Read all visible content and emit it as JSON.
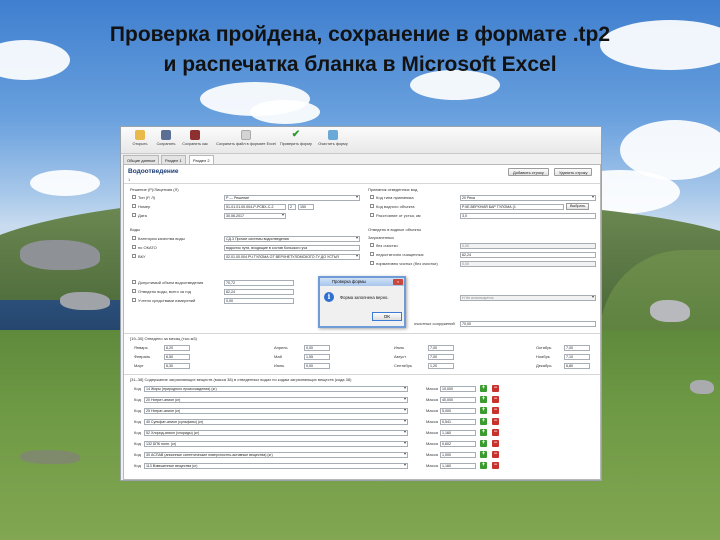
{
  "slide": {
    "title_line1": "Проверка пройдена, сохранение в формате .tp2",
    "title_line2": "и распечатка бланка в Microsoft Excel"
  },
  "toolbar": {
    "buttons": [
      {
        "label": "Открыть",
        "icon": "folder-icon"
      },
      {
        "label": "Сохранить",
        "icon": "save-icon"
      },
      {
        "label": "Сохранить как",
        "icon": "save-as-icon"
      },
      {
        "label": "Сохранить файл в формате Excel",
        "icon": "excel-icon"
      },
      {
        "label": "Проверить форму",
        "icon": "checkmark-icon"
      },
      {
        "label": "Очистить форму",
        "icon": "clear-icon"
      }
    ]
  },
  "tabs": [
    "Общие данные",
    "Раздел 1",
    "Раздел 2"
  ],
  "panel": {
    "title": "Водоотведение",
    "subtitle": "1",
    "add_row": "Добавить строку",
    "delete_row": "Удалить строку"
  },
  "left": {
    "section_decision": "Решение (Р)/Лицензия (Л)",
    "type_label": "Тип (Р, Л)",
    "type_value": "Р — Решение",
    "number_label": "Номер",
    "number_value": "51-01.01.00.004-Р-РСВХ-С-2",
    "number_suffix": "2",
    "number_extra": "150",
    "date_label": "Дата",
    "date_value": "30.06.2017",
    "section_water": "Воды",
    "category_label": "Категория качества воды",
    "category_value": "СД.3 Прочие системы водоотведения",
    "okato_label": "по ОКАТО",
    "okato_value": "водосток пути, входящие в состав Кольского уча",
    "vku_label": "ВКУ",
    "vku_value": "02.01.00.004 РЧ ТУЛОМА ОТ ВЕРХНЕТУЛОМСКОГО ГУ ДО УСТЬЯ",
    "allowed_label": "Допустимый объем водоотведения",
    "allowed_value": "70,72",
    "total_label": "Отведено воды, всего за год",
    "total_value": "62,24",
    "meter_label": "Учтено средствами измерений",
    "meter_value": "0,00"
  },
  "right": {
    "section_receiver": "Приемник отведенных вод",
    "receiver_code_label": "Код типа приемника",
    "receiver_code_value": "20 Река",
    "object_code_label": "Код водного объекта",
    "object_code_value": "Р.ЧЕ.ВЕРХНИЙ БАР ТУЛОМА (1",
    "select_button": "Выбрать",
    "distance_label": "Расстояние от устья, км",
    "distance_value": "3,0",
    "section_discharged": "Отведено в водные объекты",
    "section_polluted": "Загрязненных",
    "no_treatment_label": "без очистки",
    "no_treatment_value": "0,00",
    "insufficient_label": "недостаточно очищенных",
    "insufficient_value": "62,24",
    "normative_label": "нормативно чистых (без очистки)",
    "normative_value": "0,00",
    "facilities_value": "Н Не используется",
    "structures_label": "очистных сооружений",
    "structures_value": "70,00"
  },
  "monthly": {
    "section": "[19–30] Отведено за месяц (тыс.м3)",
    "months": [
      {
        "name": "Январь",
        "value": "6,20"
      },
      {
        "name": "Февраль",
        "value": "6,50"
      },
      {
        "name": "Март",
        "value": "6,30"
      },
      {
        "name": "Апрель",
        "value": "0,00"
      },
      {
        "name": "Май",
        "value": "1,55"
      },
      {
        "name": "Июнь",
        "value": "0,00"
      },
      {
        "name": "Июль",
        "value": "7,00"
      },
      {
        "name": "Август",
        "value": "7,00"
      },
      {
        "name": "Сентябрь",
        "value": "1,20"
      },
      {
        "name": "Октябрь",
        "value": "7,00"
      },
      {
        "name": "Ноябрь",
        "value": "7,10"
      },
      {
        "name": "Декабрь",
        "value": "6,80"
      }
    ]
  },
  "substances": {
    "section": "[31–38] Содержание загрязняющих веществ (масса 38) в отведенных водах по кодам загрязняющих веществ (кода 38)",
    "code_label": "Код",
    "mass_label": "Масса",
    "rows": [
      {
        "name": "14 Жиры (природного происхождения) (кг)",
        "mass": "10,000"
      },
      {
        "name": "20 Нитрит-анион (кг)",
        "mass": "40,000"
      },
      {
        "name": "25 Нитрат-анион (кг)",
        "mass": "5,000"
      },
      {
        "name": "40 Сульфат-анион (сульфаты) (кг)",
        "mass": "0,541"
      },
      {
        "name": "52 Хлорид-анион (хлориды) (кг)",
        "mass": "1,160"
      },
      {
        "name": "132 БПК полн. (кг)",
        "mass": "0,602"
      },
      {
        "name": "30 АСПАВ (анионные синтетические поверхностно-активные вещества) (кг)",
        "mass": "1,000"
      },
      {
        "name": "113 Взвешенные вещества (кг)",
        "mass": "1,160"
      }
    ]
  },
  "dialog": {
    "title": "Проверка формы",
    "message": "Форма заполнена верно.",
    "ok": "OK",
    "close": "×"
  }
}
